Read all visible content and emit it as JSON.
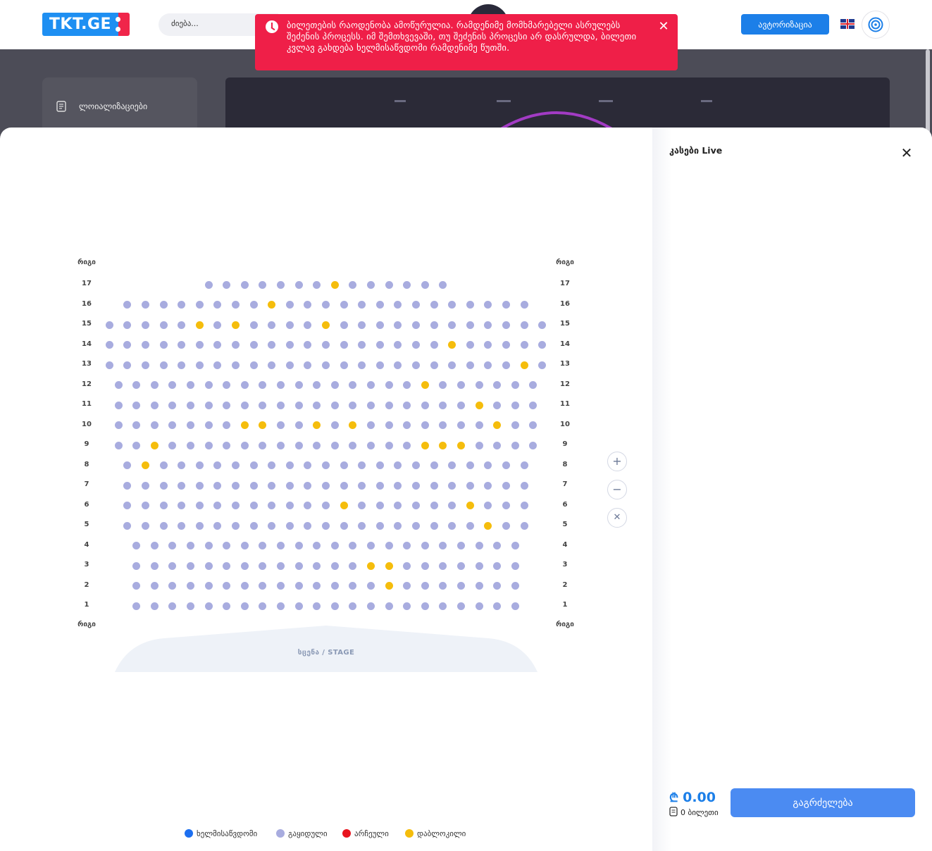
{
  "header": {
    "logo_text": "TKT.GE",
    "search_placeholder": "ძიება...",
    "auth_label": "ავტორიზაცია",
    "lang_icon": "uk-flag-icon",
    "target_icon": "target-icon"
  },
  "sidebar": {
    "items": [
      {
        "label": "ლოიალიზაციები",
        "icon": "ticket-icon"
      }
    ]
  },
  "toast": {
    "message": "ბილეთების რაოდენობა ამოწურულია. რამდენიმე მომხმარებელი ასრულებს შეძენის პროცესს. იმ შემთხვევაში, თუ შეძენის პროცესი არ დასრულდა, ბილეთი კვლავ გახდება ხელმისაწვდომი რამდენიმე წუთში.",
    "color": "#ef1f48"
  },
  "seatmap": {
    "row_header": "რიგი",
    "stage_label": "სცენა / STAGE",
    "colors": {
      "available": "#1c6ff0",
      "sold": "#a8acdf",
      "selected": "#e8141e",
      "reserved": "#f5bd0c"
    },
    "rows": [
      {
        "row": "17",
        "seats": 14,
        "reserved": [
          8
        ]
      },
      {
        "row": "16",
        "seats": 23,
        "reserved": [
          9
        ]
      },
      {
        "row": "15",
        "seats": 25,
        "reserved": [
          6,
          8,
          13
        ]
      },
      {
        "row": "14",
        "seats": 25,
        "reserved": [
          20
        ]
      },
      {
        "row": "13",
        "seats": 25,
        "reserved": [
          24
        ]
      },
      {
        "row": "12",
        "seats": 24,
        "reserved": [
          18
        ]
      },
      {
        "row": "11",
        "seats": 24,
        "reserved": [
          21
        ]
      },
      {
        "row": "10",
        "seats": 24,
        "reserved": [
          8,
          9,
          12,
          14,
          22
        ]
      },
      {
        "row": "9",
        "seats": 24,
        "reserved": [
          3,
          18,
          19,
          20
        ]
      },
      {
        "row": "8",
        "seats": 23,
        "reserved": [
          2
        ]
      },
      {
        "row": "7",
        "seats": 23,
        "reserved": []
      },
      {
        "row": "6",
        "seats": 23,
        "reserved": [
          13,
          20
        ]
      },
      {
        "row": "5",
        "seats": 23,
        "reserved": [
          21
        ]
      },
      {
        "row": "4",
        "seats": 22,
        "reserved": []
      },
      {
        "row": "3",
        "seats": 22,
        "reserved": [
          14,
          15
        ]
      },
      {
        "row": "2",
        "seats": 22,
        "reserved": [
          15
        ]
      },
      {
        "row": "1",
        "seats": 22,
        "reserved": []
      }
    ],
    "zoom_in_icon": "plus-icon",
    "zoom_out_icon": "minus-icon",
    "reset_icon": "close-icon"
  },
  "legend": [
    {
      "label": "ხელმისაწვდომი",
      "color": "#1c6ff0"
    },
    {
      "label": "გაყიდული",
      "color": "#a8acdf"
    },
    {
      "label": "არჩეული",
      "color": "#e8141e"
    },
    {
      "label": "დაბლოკილი",
      "color": "#f5bd0c"
    }
  ],
  "panel": {
    "title": "კასები Live",
    "price": "0.00",
    "currency_symbol": "₾",
    "tickets_count": "0 ბილეთი",
    "continue_label": "გაგრძელება"
  }
}
